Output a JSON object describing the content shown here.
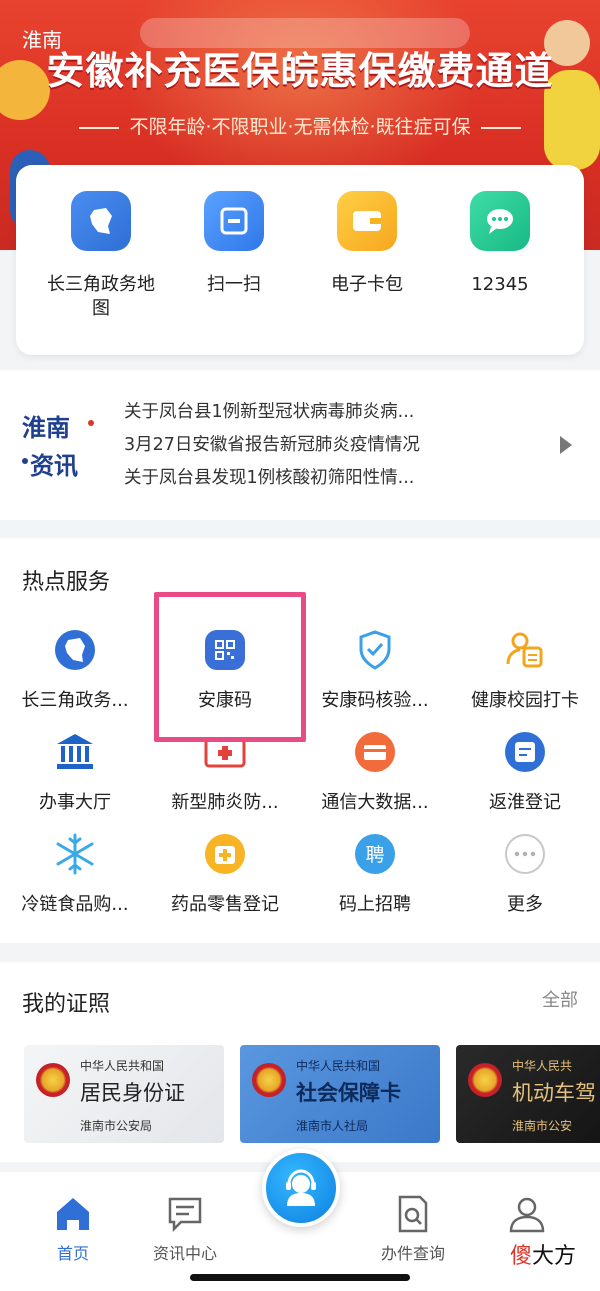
{
  "header": {
    "city": "淮南",
    "banner_title": "安徽补充医保皖惠保缴费通道",
    "banner_subtitle": "不限年龄·不限职业·无需体检·既往症可保"
  },
  "quick_actions": [
    {
      "label": "长三角政务地图",
      "icon": "map-icon",
      "color": "#2f6fd6"
    },
    {
      "label": "扫一扫",
      "icon": "scan-icon",
      "color": "#3b82f6"
    },
    {
      "label": "电子卡包",
      "icon": "wallet-icon",
      "color": "#f6b51e"
    },
    {
      "label": "12345",
      "icon": "chat-icon",
      "color": "#22c38e"
    }
  ],
  "news": {
    "logo_top": "淮南",
    "logo_bottom": "资讯",
    "items": [
      "关于凤台县1例新型冠状病毒肺炎病...",
      "3月27日安徽省报告新冠肺炎疫情情况",
      "关于凤台县发现1例核酸初筛阳性情..."
    ]
  },
  "hot_services": {
    "title": "热点服务",
    "items": [
      {
        "label": "长三角政务...",
        "icon": "map-icon"
      },
      {
        "label": "安康码",
        "icon": "qr-code-icon"
      },
      {
        "label": "安康码核验...",
        "icon": "shield-check-icon"
      },
      {
        "label": "健康校园打卡",
        "icon": "person-card-icon"
      },
      {
        "label": "办事大厅",
        "icon": "government-hall-icon"
      },
      {
        "label": "新型肺炎防...",
        "icon": "medical-kit-icon"
      },
      {
        "label": "通信大数据...",
        "icon": "card-icon"
      },
      {
        "label": "返淮登记",
        "icon": "register-icon"
      },
      {
        "label": "冷链食品购...",
        "icon": "snowflake-icon"
      },
      {
        "label": "药品零售登记",
        "icon": "medicine-box-icon"
      },
      {
        "label": "码上招聘",
        "icon": "recruit-icon"
      },
      {
        "label": "更多",
        "icon": "more-icon"
      }
    ]
  },
  "certificates": {
    "title": "我的证照",
    "all_label": "全部",
    "items": [
      {
        "country": "中华人民共和国",
        "name": "居民身份证",
        "issuer": "淮南市公安局",
        "bg": "#eef0f2"
      },
      {
        "country": "中华人民共和国",
        "name": "社会保障卡",
        "issuer": "淮南市人社局",
        "bg": "#4a8ad6"
      },
      {
        "country": "中华人民共",
        "name": "机动车驾",
        "issuer": "淮南市公安",
        "bg": "#1e1e1e"
      }
    ]
  },
  "tabbar": {
    "items": [
      {
        "label": "首页",
        "icon": "home-icon",
        "active": true
      },
      {
        "label": "资讯中心",
        "icon": "message-icon",
        "active": false
      },
      {
        "label": "办件查询",
        "icon": "document-search-icon",
        "active": false
      },
      {
        "label": "",
        "icon": "user-icon",
        "active": false
      }
    ]
  },
  "watermark": {
    "first": "傻",
    "rest": "大方"
  }
}
